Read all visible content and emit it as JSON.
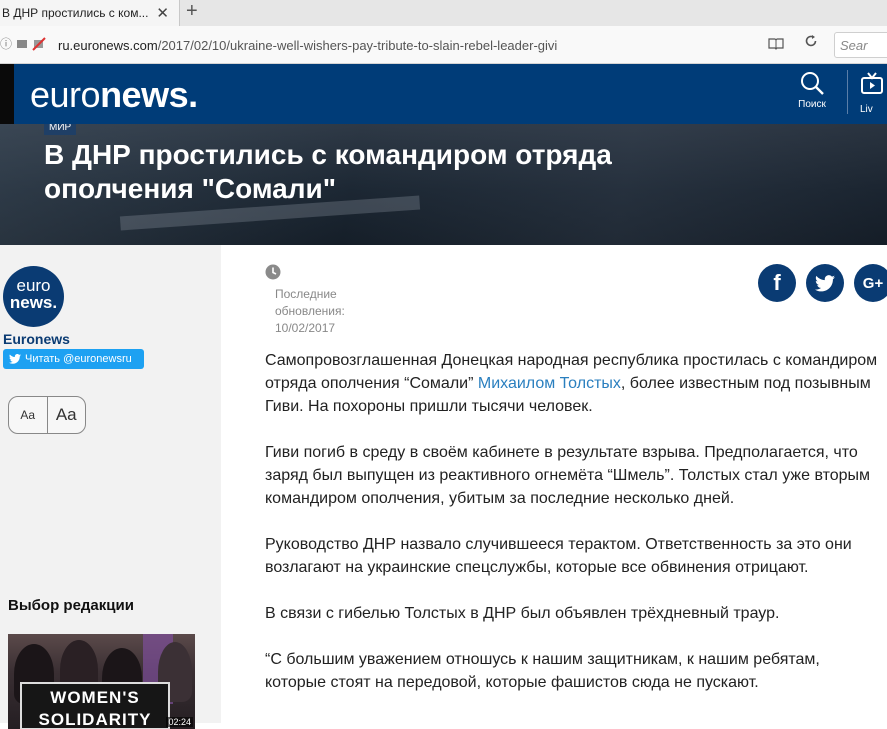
{
  "browser": {
    "tab_title": "В ДНР простились с ком...",
    "close_glyph": "✕",
    "new_tab_glyph": "+",
    "url_host": "ru.euronews.com",
    "url_path": "/2017/02/10/ukraine-well-wishers-pay-tribute-to-slain-rebel-leader-givi",
    "search_placeholder": "Sear"
  },
  "header": {
    "logo_light": "euro",
    "logo_bold": "news.",
    "search_label": "Поиск",
    "live_label": "Liv"
  },
  "hero": {
    "category": "МИР",
    "headline": "В ДНР простились с командиром отряда ополчения \"Сомали\""
  },
  "sidebar": {
    "avatar_line1": "euro",
    "avatar_line2": "news.",
    "brand_name": "Euronews",
    "follow_label": "Читать @euronewsru",
    "font_small": "Aa",
    "font_large": "Aa",
    "editor_pick_title": "Выбор редакции",
    "thumb_sign_line1": "WOMEN'S",
    "thumb_sign_line2": "SOLIDARITY",
    "thumb_time": "02:24"
  },
  "article": {
    "updated_label_1": "Последние",
    "updated_label_2": "обновления:",
    "updated_date": "10/02/2017",
    "share_facebook": "f",
    "share_gplus": "G+",
    "p1_before": "Самопровозглашенная Донецкая народная республика простилась с командиром отряда ополчения “Сомали” ",
    "p1_link": "Михаилом Толстых",
    "p1_after": ", более известным под позывным Гиви. На похороны пришли тысячи человек.",
    "p2": "Гиви погиб в среду в своём кабинете в результате взрыва. Предполагается, что заряд был выпущен из реактивного огнемёта “Шмель”. Толстых стал уже вторым командиром ополчения, убитым за последние несколько дней.",
    "p3": "Руководство ДНР назвало случившееся терактом. Ответственность за это они возлагают на украинские спецслужбы, которые все обвинения отрицают.",
    "p4": "В связи с гибелью Толстых в ДНР был объявлен трёхдневный траур.",
    "p5": "“С большим уважением отношусь к нашим защитникам, к нашим ребятам, которые стоят на передовой, которые фашистов сюда не пускают."
  },
  "colors": {
    "brand_blue": "#003c78",
    "share_blue": "#0a3b73",
    "link_blue": "#2a7fbf",
    "twitter_blue": "#1da1f2"
  }
}
